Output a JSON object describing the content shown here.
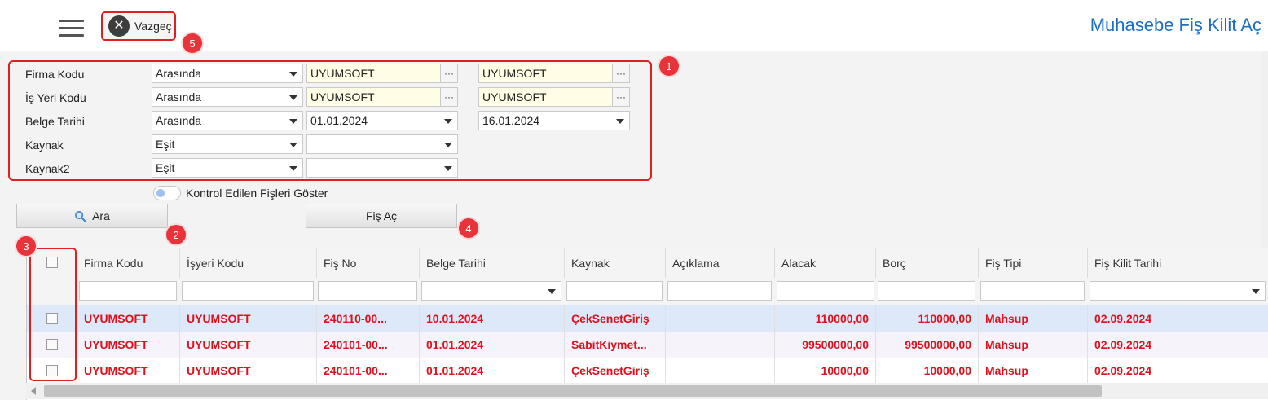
{
  "toolbar": {
    "cancel_label": "Vazgeç",
    "page_title": "Muhasebe Fiş Kilit Aç"
  },
  "badges": [
    "1",
    "2",
    "3",
    "4",
    "5"
  ],
  "filters": [
    {
      "label": "Firma Kodu",
      "operator": "Arasında",
      "value1": "UYUMSOFT",
      "value2": "UYUMSOFT",
      "kind": "lookup"
    },
    {
      "label": "İş Yeri Kodu",
      "operator": "Arasında",
      "value1": "UYUMSOFT",
      "value2": "UYUMSOFT",
      "kind": "lookup"
    },
    {
      "label": "Belge Tarihi",
      "operator": "Arasında",
      "value1": "01.01.2024",
      "value2": "16.01.2024",
      "kind": "date"
    },
    {
      "label": "Kaynak",
      "operator": "Eşit",
      "value1": "",
      "kind": "select"
    },
    {
      "label": "Kaynak2",
      "operator": "Eşit",
      "value1": "",
      "kind": "select"
    }
  ],
  "lookup_button": "···",
  "toggle_label": "Kontrol Edilen Fişleri Göster",
  "buttons": {
    "search": "Ara",
    "open": "Fiş Aç"
  },
  "grid": {
    "columns": [
      "Firma Kodu",
      "İşyeri Kodu",
      "Fiş No",
      "Belge Tarihi",
      "Kaynak",
      "Açıklama",
      "Alacak",
      "Borç",
      "Fiş Tipi",
      "Fiş Kilit Tarihi"
    ],
    "rows": [
      [
        "UYUMSOFT",
        "UYUMSOFT",
        "240110-00...",
        "10.01.2024",
        "ÇekSenetGiriş",
        "",
        "110000,00",
        "110000,00",
        "Mahsup",
        "02.09.2024"
      ],
      [
        "UYUMSOFT",
        "UYUMSOFT",
        "240101-00...",
        "01.01.2024",
        "SabitKiymet...",
        "",
        "99500000,00",
        "99500000,00",
        "Mahsup",
        "02.09.2024"
      ],
      [
        "UYUMSOFT",
        "UYUMSOFT",
        "240101-00...",
        "01.01.2024",
        "ÇekSenetGiriş",
        "",
        "10000,00",
        "10000,00",
        "Mahsup",
        "02.09.2024"
      ]
    ]
  },
  "colors": {
    "accent": "#1b6fc2",
    "annotation_red": "#e02020",
    "row_text": "#e0101e",
    "selected_row": "#dde8f8",
    "alt_row": "#f6f3fb",
    "lookup_input_bg": "#fffde6"
  }
}
